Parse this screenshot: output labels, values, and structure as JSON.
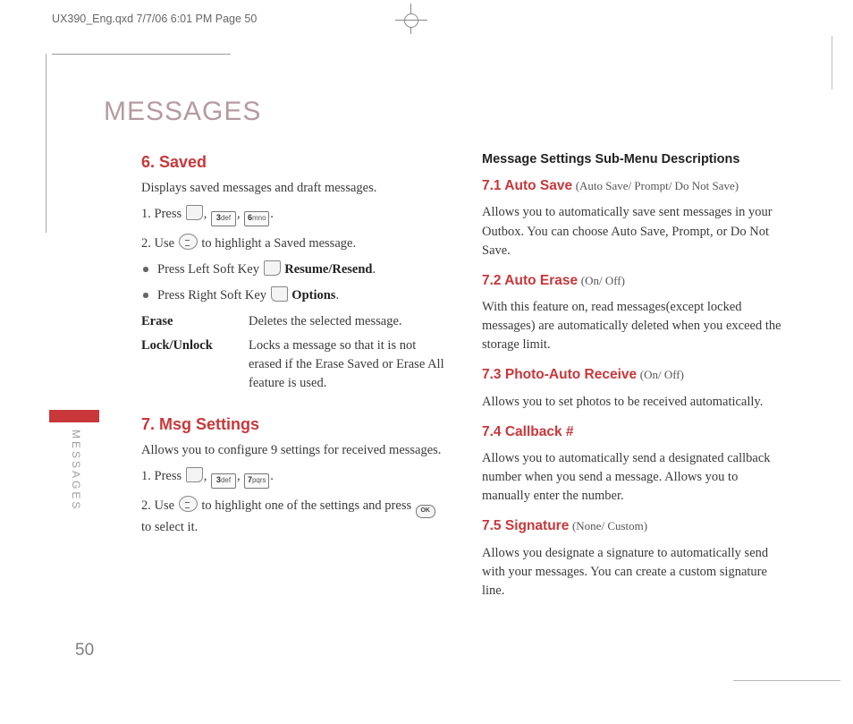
{
  "print": {
    "header": "UX390_Eng.qxd  7/7/06  6:01 PM  Page 50"
  },
  "chapter": "MESSAGES",
  "side_label": "MESSAGES",
  "page_number": "50",
  "left": {
    "s6": {
      "title": "6. Saved",
      "intro": "Displays saved messages and draft messages.",
      "step1_a": "1. Press ",
      "step1_b": ", ",
      "step1_c": ", ",
      "step1_d": ".",
      "key1": "3 def",
      "key2": "6 mno",
      "step2_a": "2. Use ",
      "step2_b": " to highlight a Saved message.",
      "b1_a": "Press Left Soft Key ",
      "b1_b": "Resume/Resend",
      "b1_c": ".",
      "b2_a": "Press Right Soft Key ",
      "b2_b": "Options",
      "b2_c": ".",
      "erase_t": "Erase",
      "erase_d": "Deletes the selected message.",
      "lock_t": "Lock/Unlock",
      "lock_d": "Locks a message so that it is not erased if the Erase Saved or Erase All feature is used."
    },
    "s7": {
      "title": "7. Msg Settings",
      "intro": "Allows you to configure 9 settings for received messages.",
      "step1_a": "1. Press ",
      "step1_b": ", ",
      "step1_c": ", ",
      "step1_d": ".",
      "key1": "3 def",
      "key2": "7 pqrs",
      "step2_a": "2. Use ",
      "step2_b": " to highlight one of the settings and press ",
      "step2_c": " to select it.",
      "ok": "OK"
    }
  },
  "right": {
    "subhead": "Message Settings Sub-Menu Descriptions",
    "i1": {
      "t": "7.1 Auto Save",
      "o": "(Auto Save/ Prompt/ Do Not Save)",
      "d": "Allows you to automatically save sent messages in your Outbox. You can choose Auto Save, Prompt, or Do Not Save."
    },
    "i2": {
      "t": "7.2 Auto Erase",
      "o": "(On/ Off)",
      "d": "With this feature on, read messages(except locked messages) are automatically deleted when you exceed the storage limit."
    },
    "i3": {
      "t": "7.3 Photo-Auto Receive",
      "o": "(On/ Off)",
      "d": "Allows you to set photos to be received automatically."
    },
    "i4": {
      "t": "7.4 Callback #",
      "o": "",
      "d": "Allows you to automatically send a designated callback number when you send a message. Allows you to manually enter the number."
    },
    "i5": {
      "t": "7.5 Signature",
      "o": "(None/ Custom)",
      "d": "Allows you designate a signature to automatically send with your messages. You can create a custom signature line."
    }
  }
}
